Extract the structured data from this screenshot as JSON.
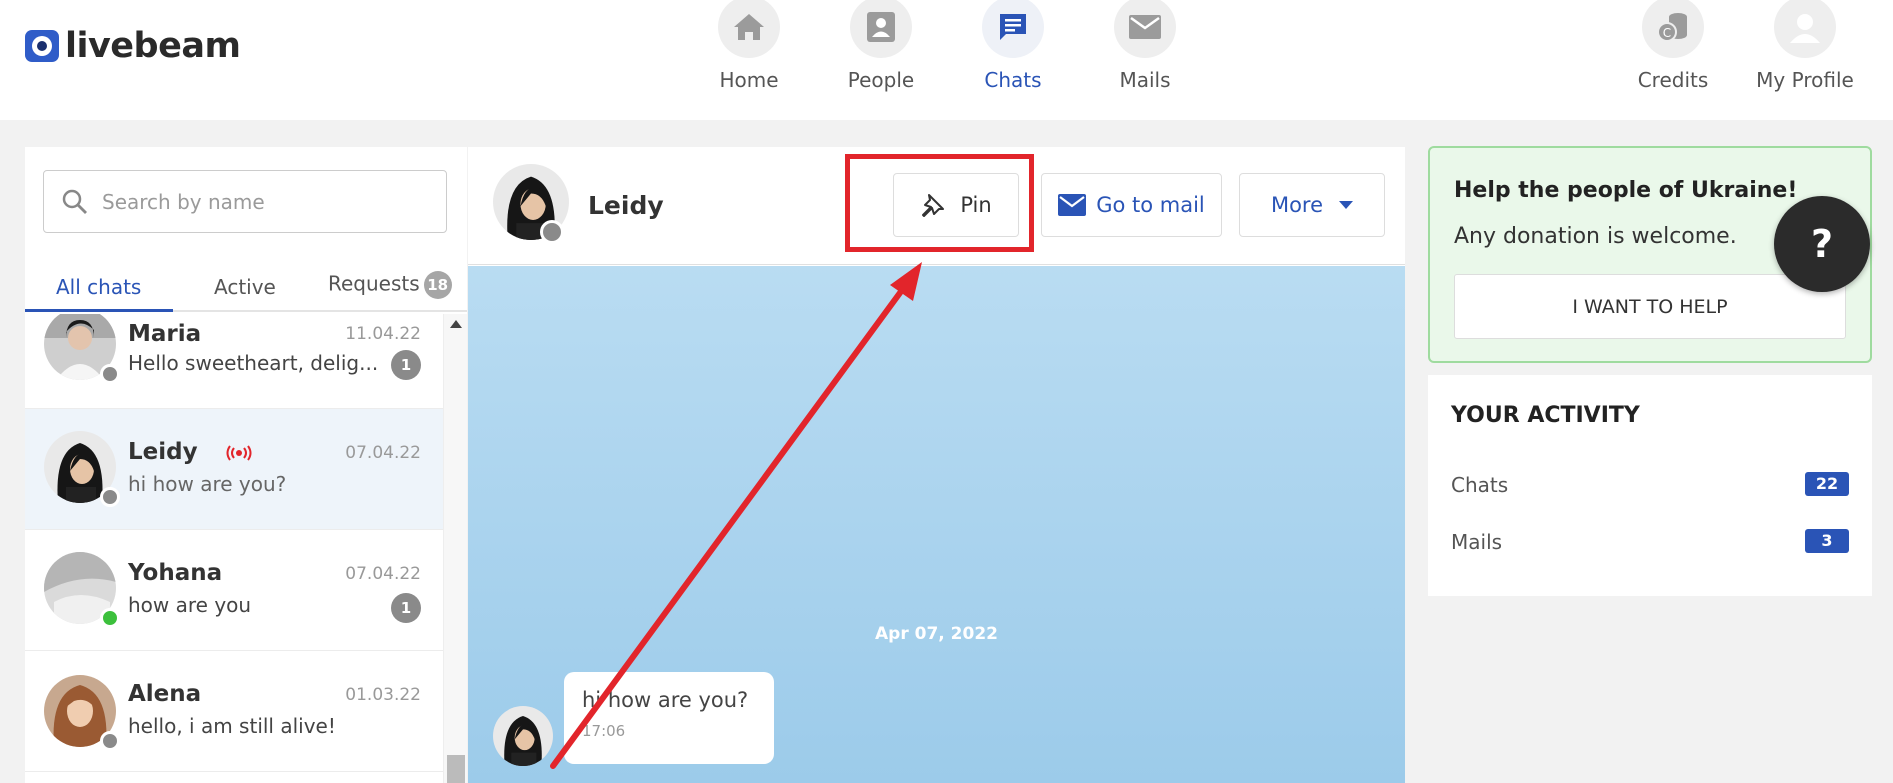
{
  "brand": {
    "name": "livebeam",
    "color": "#2f5cc8"
  },
  "nav": {
    "items": [
      {
        "label": "Home",
        "icon": "home-icon",
        "active": false
      },
      {
        "label": "People",
        "icon": "people-icon",
        "active": false
      },
      {
        "label": "Chats",
        "icon": "chats-icon",
        "active": true
      },
      {
        "label": "Mails",
        "icon": "mail-icon",
        "active": false
      }
    ],
    "right": [
      {
        "label": "Credits",
        "icon": "credits-icon"
      },
      {
        "label": "My Profile",
        "icon": "profile-icon"
      }
    ]
  },
  "search": {
    "placeholder": "Search by name",
    "value": ""
  },
  "tabs": [
    {
      "label": "All chats",
      "active": true
    },
    {
      "label": "Active",
      "active": false
    },
    {
      "label": "Requests",
      "badge": "18",
      "active": false
    }
  ],
  "chats": [
    {
      "name": "Maria",
      "date": "11.04.22",
      "preview": "Hello sweetheart, delig...",
      "unread": "1",
      "status": "offline"
    },
    {
      "name": "Leidy",
      "date": "07.04.22",
      "preview": "hi how are you?",
      "unread": "",
      "status": "offline",
      "live": true,
      "selected": true
    },
    {
      "name": "Yohana",
      "date": "07.04.22",
      "preview": "how are you",
      "unread": "1",
      "status": "online"
    },
    {
      "name": "Alena",
      "date": "01.03.22",
      "preview": "hello, i am still alive!",
      "unread": "",
      "status": "offline"
    }
  ],
  "conversation": {
    "name": "Leidy",
    "buttons": {
      "pin": "Pin",
      "mail": "Go to mail",
      "more": "More"
    },
    "date_separator": "Apr 07, 2022",
    "messages": [
      {
        "text": "hi how are you?",
        "time": "17:06"
      }
    ]
  },
  "ukraine": {
    "title": "Help the people of Ukraine!",
    "subtitle": "Any donation is welcome.",
    "button": "I WANT TO HELP"
  },
  "help_button": "?",
  "activity": {
    "title": "YOUR ACTIVITY",
    "rows": [
      {
        "label": "Chats",
        "count": "22"
      },
      {
        "label": "Mails",
        "count": "3"
      }
    ]
  },
  "colors": {
    "accent": "#2a54b6",
    "annotation": "#e2252b",
    "online": "#3cc03c",
    "offline": "#8a8a8a"
  }
}
